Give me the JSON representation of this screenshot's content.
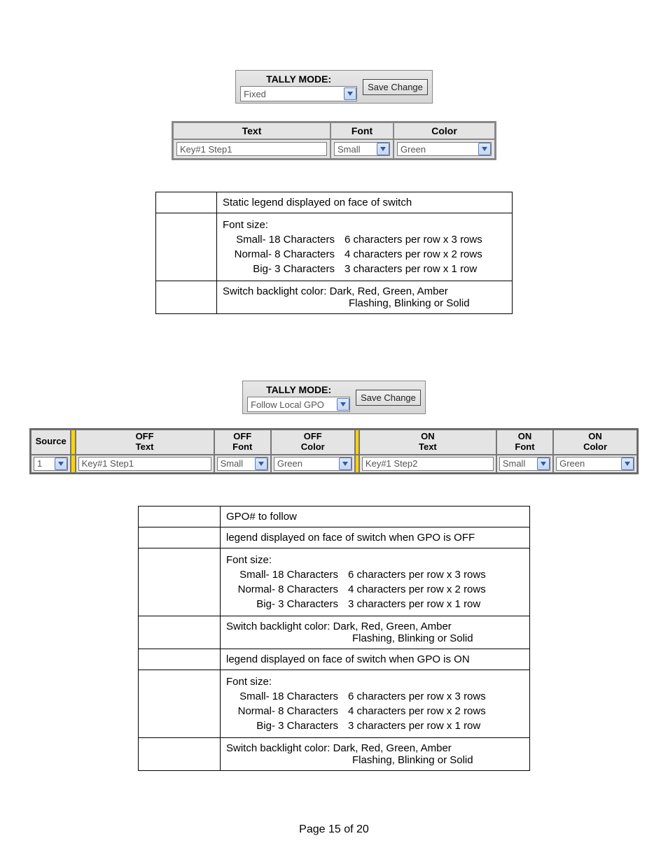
{
  "tally1": {
    "title": "TALLY MODE:",
    "value": "Fixed",
    "save": "Save Change"
  },
  "smallgrid": {
    "headers": {
      "text": "Text",
      "font": "Font",
      "color": "Color"
    },
    "row": {
      "text": "Key#1 Step1",
      "font": "Small",
      "color": "Green"
    }
  },
  "desc1": {
    "r1": "Static legend displayed on face of switch",
    "r2_title": "Font size:",
    "r2_a_left": "Small-  18 Characters",
    "r2_a_right": "6 characters per row x 3 rows",
    "r2_b_left": "Normal-   8  Characters",
    "r2_b_right": "4 characters per row x 2 rows",
    "r2_c_left": "Big-   3  Characters",
    "r2_c_right": "3 characters per row x 1 row",
    "r3_a": "Switch backlight color:  Dark, Red, Green, Amber",
    "r3_b": "Flashing, Blinking or Solid"
  },
  "tally2": {
    "title": "TALLY MODE:",
    "value": "Follow Local GPO",
    "save": "Save Change"
  },
  "wide": {
    "headers": {
      "source": "Source",
      "off_text": "OFF\nText",
      "off_font": "OFF\nFont",
      "off_color": "OFF\nColor",
      "on_text": "ON\nText",
      "on_font": "ON\nFont",
      "on_color": "ON\nColor"
    },
    "row": {
      "source": "1",
      "off_text": "Key#1 Step1",
      "off_font": "Small",
      "off_color": "Green",
      "on_text": "Key#1 Step2",
      "on_font": "Small",
      "on_color": "Green"
    }
  },
  "desc2": {
    "r1": "GPO# to follow",
    "r2": "legend displayed on face of switch when GPO is OFF",
    "r3_title": "Font size:",
    "r3_a_left": "Small-  18 Characters",
    "r3_a_right": "6 characters per row x 3 rows",
    "r3_b_left": "Normal-   8  Characters",
    "r3_b_right": "4 characters per row x 2 rows",
    "r3_c_left": "Big-   3  Characters",
    "r3_c_right": "3 characters per row x 1 row",
    "r4_a": "Switch backlight color:  Dark, Red, Green, Amber",
    "r4_b": "Flashing, Blinking or Solid",
    "r5": "legend displayed on face of switch when GPO is ON",
    "r6_title": "Font size:",
    "r6_a_left": "Small-  18 Characters",
    "r6_a_right": "6 characters per row x 3 rows",
    "r6_b_left": "Normal-   8  Characters",
    "r6_b_right": "4 characters per row x 2 rows",
    "r6_c_left": "Big-   3  Characters",
    "r6_c_right": "3 characters per row x 1 row",
    "r7_a": "Switch backlight color:  Dark, Red, Green, Amber",
    "r7_b": "Flashing, Blinking or Solid"
  },
  "footer": "Page 15 of 20"
}
